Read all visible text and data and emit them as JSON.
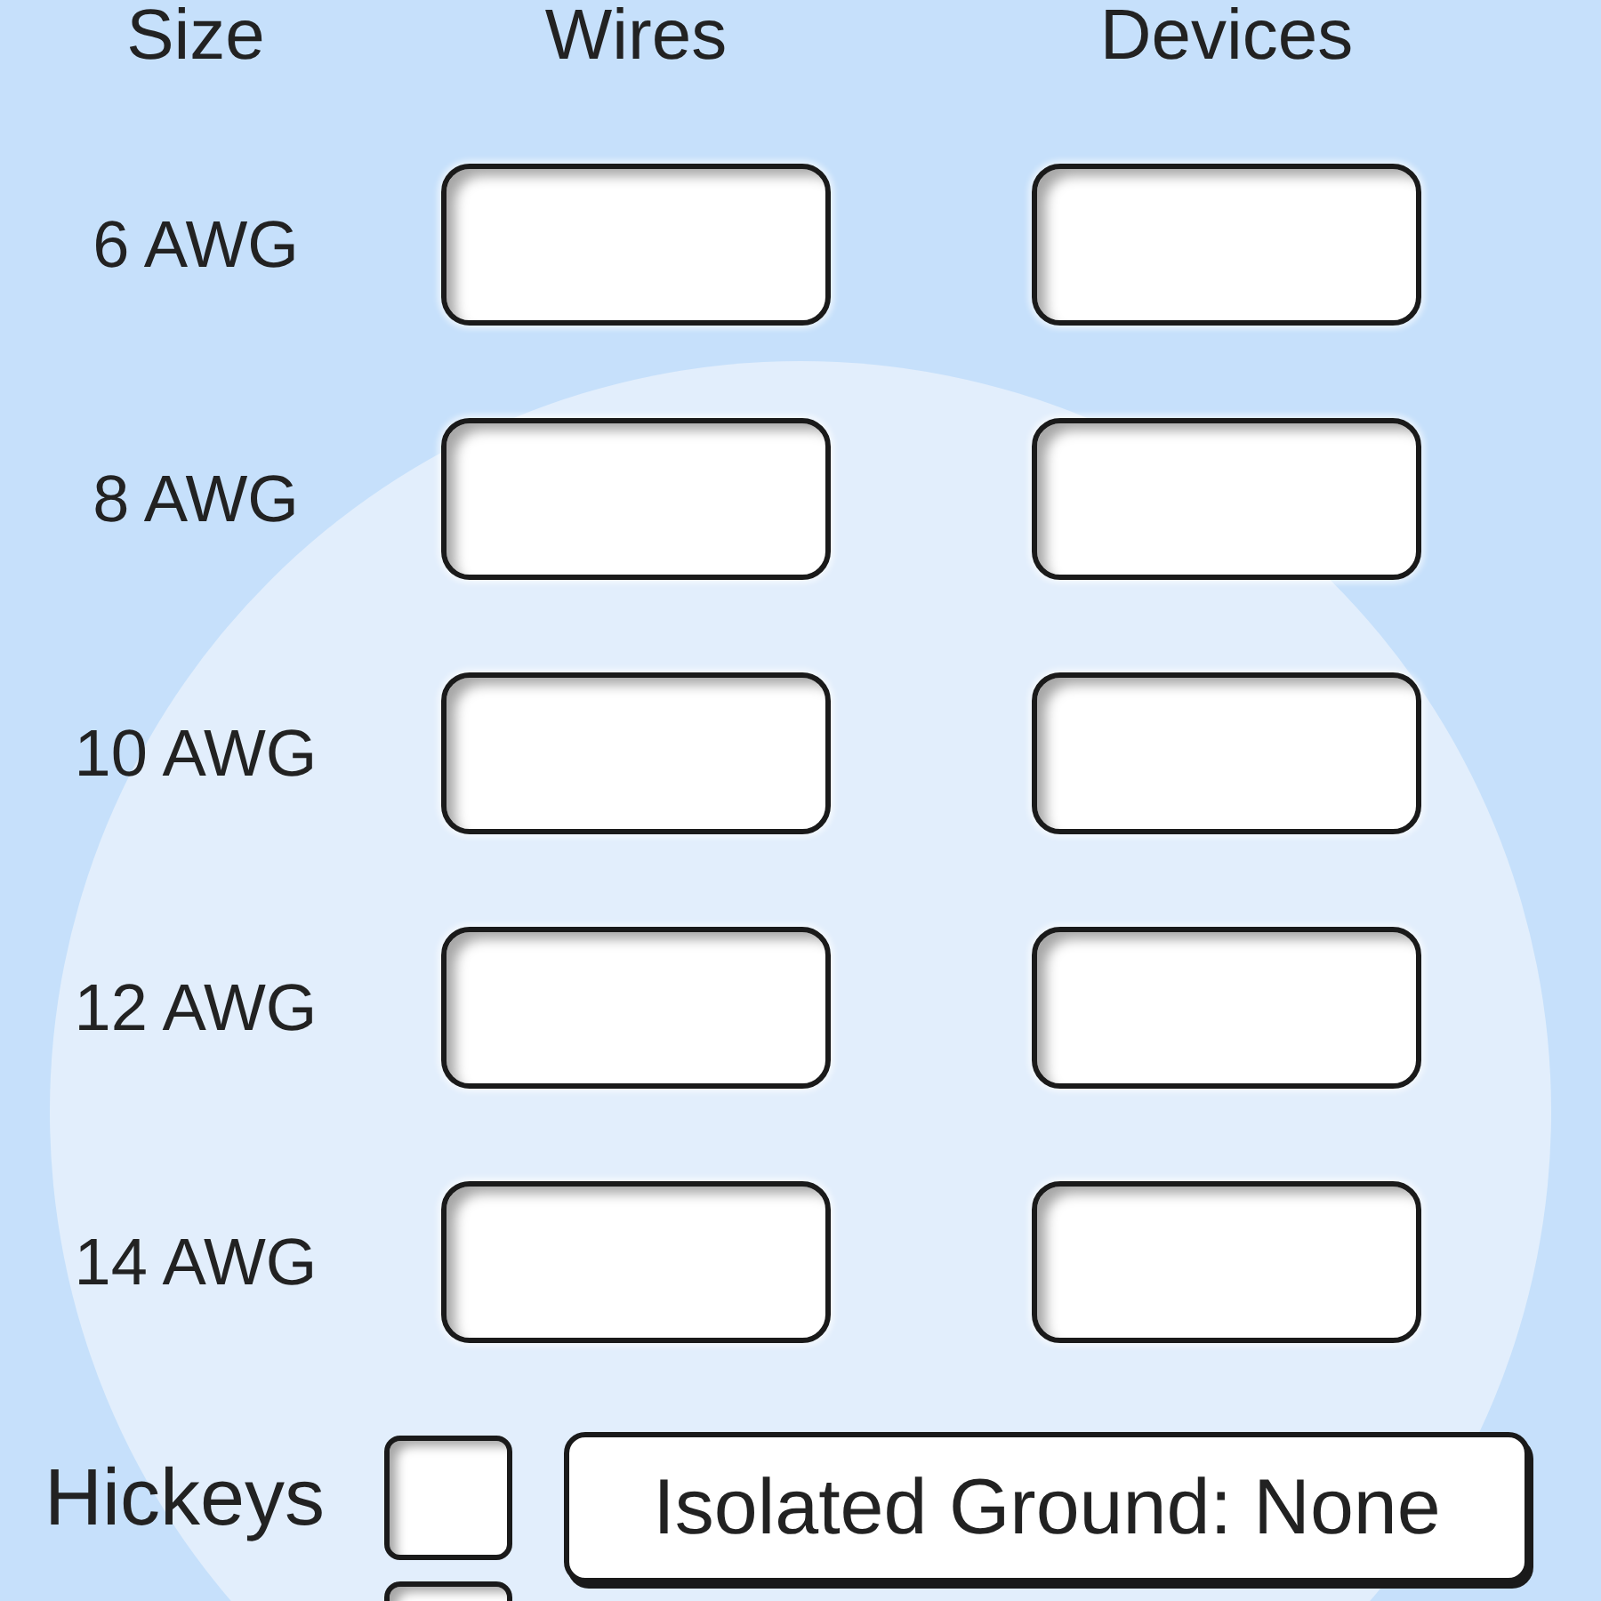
{
  "columns": {
    "size": "Size",
    "wires": "Wires",
    "devices": "Devices"
  },
  "rows": [
    {
      "size": "6 AWG"
    },
    {
      "size": "8 AWG"
    },
    {
      "size": "10 AWG"
    },
    {
      "size": "12 AWG"
    },
    {
      "size": "14 AWG"
    }
  ],
  "options": [
    {
      "label": "Hickeys",
      "checked": false
    },
    {
      "checked": false
    }
  ],
  "isolated_ground_button": "Isolated Ground: None"
}
